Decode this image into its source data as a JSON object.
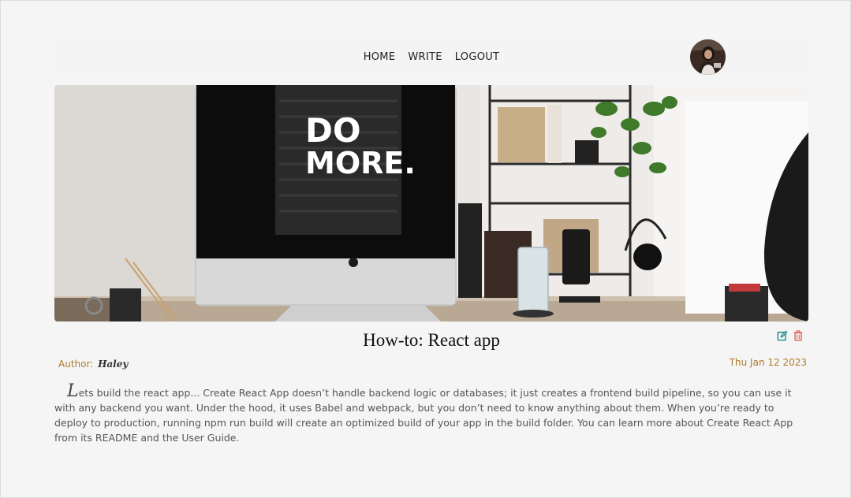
{
  "nav": {
    "home": "HOME",
    "write": "WRITE",
    "logout": "LOGOUT"
  },
  "hero": {
    "sign_line1": "DO",
    "sign_line2": "MORE."
  },
  "post": {
    "title": "How-to: React app",
    "author_label": "Author:",
    "author_name": "Haley",
    "date": "Thu Jan 12 2023",
    "dropcap": "L",
    "body": "ets build the react app... Create React App doesn’t handle backend logic or databases; it just creates a frontend build pipeline, so you can use it with any backend you want. Under the hood, it uses Babel and webpack, but you don’t need to know anything about them. When you’re ready to deploy to production, running npm run build will create an optimized build of your app in the build folder. You can learn more about Create React App from its README and the User Guide."
  },
  "icons": {
    "edit": "edit-icon",
    "delete": "trash-icon"
  },
  "colors": {
    "accent": "#b07a2a",
    "edit": "#1a8a8a",
    "delete": "#e05a47"
  }
}
